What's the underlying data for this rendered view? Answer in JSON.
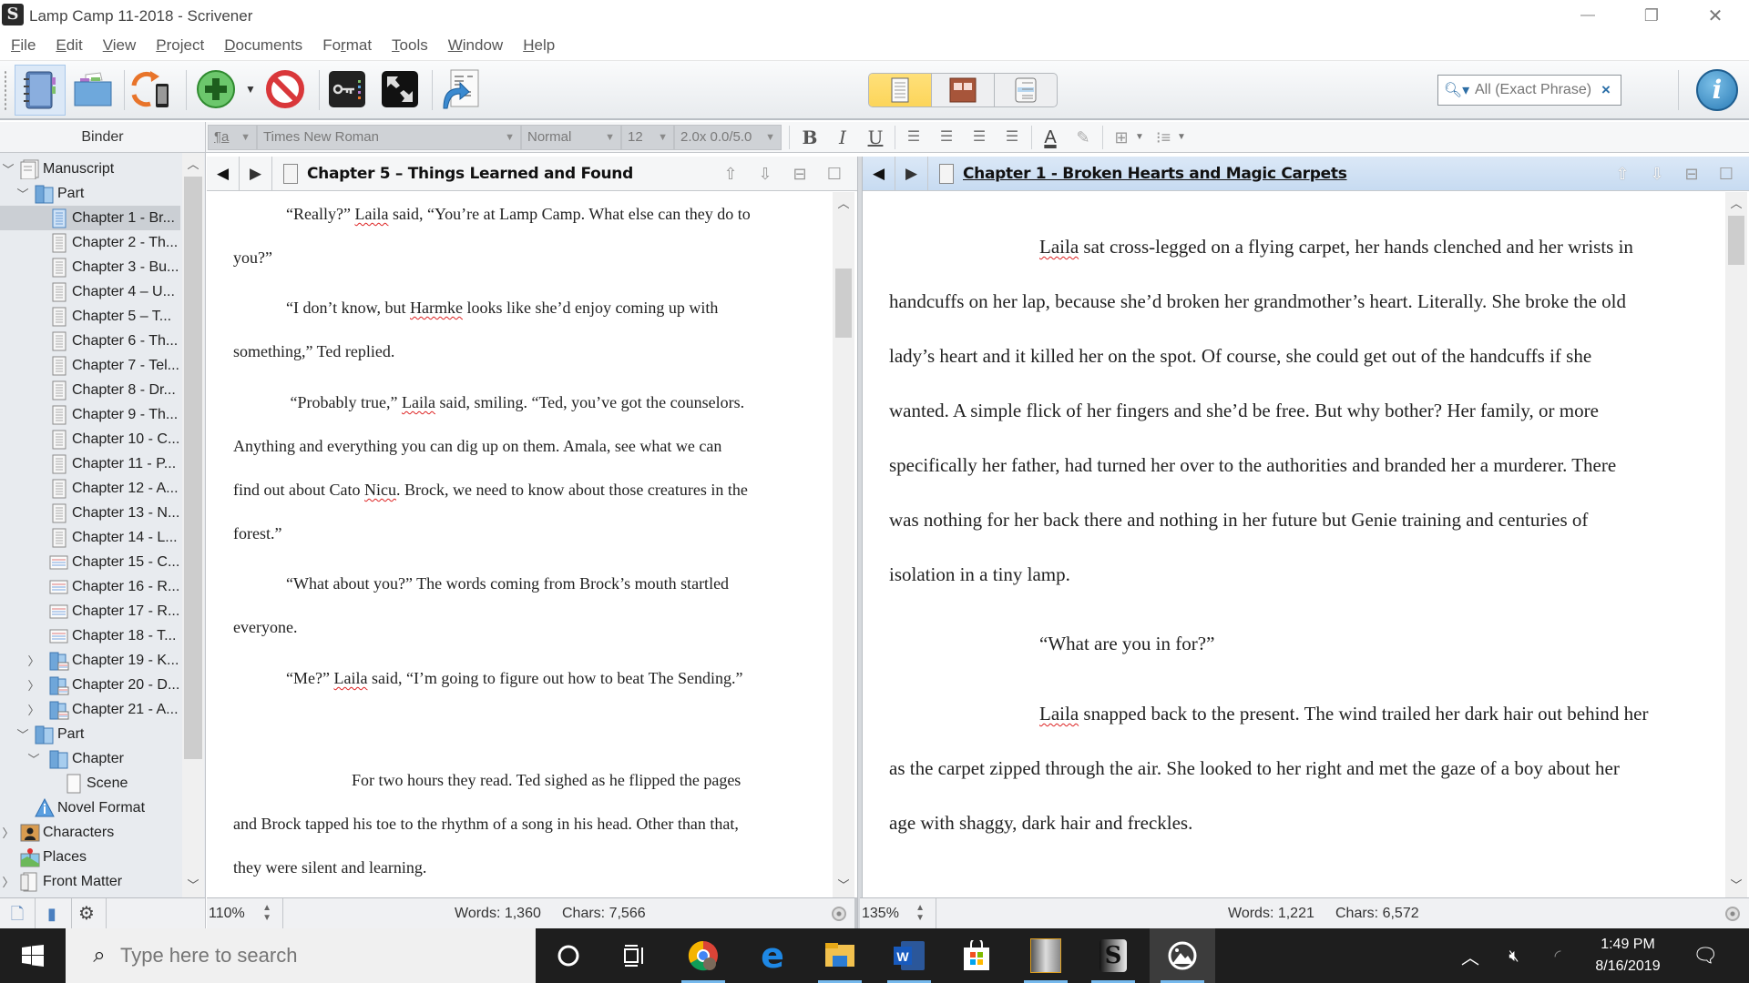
{
  "window": {
    "title": "Lamp Camp 11-2018 - Scrivener",
    "controls": {
      "minimize": "—",
      "restore": "❐",
      "close": "✕"
    }
  },
  "menu": [
    {
      "label": "File",
      "accel": "F",
      "rest": "ile"
    },
    {
      "label": "Edit",
      "accel": "E",
      "rest": "dit"
    },
    {
      "label": "View",
      "accel": "V",
      "rest": "iew"
    },
    {
      "label": "Project",
      "accel": "P",
      "rest": "roject"
    },
    {
      "label": "Documents",
      "accel": "D",
      "rest": "ocuments"
    },
    {
      "label": "Format",
      "pre": "Fo",
      "accel": "r",
      "rest": "mat"
    },
    {
      "label": "Tools",
      "accel": "T",
      "rest": "ools"
    },
    {
      "label": "Window",
      "accel": "W",
      "rest": "indow"
    },
    {
      "label": "Help",
      "accel": "H",
      "rest": "elp"
    }
  ],
  "toolbar": {
    "buttons": [
      "binder",
      "collections",
      "sync",
      "add",
      "add-dropdown",
      "delete",
      "keywords",
      "composition-mode",
      "compile"
    ],
    "view_modes": [
      "scrivenings",
      "corkboard",
      "outliner"
    ],
    "active_view_mode": "scrivenings",
    "search": {
      "placeholder": "All (Exact Phrase)",
      "value": ""
    },
    "colors": {
      "view_active": "#fcd55a",
      "info": "#2a7bb6"
    }
  },
  "binder": {
    "header": "Binder",
    "items": [
      {
        "label": "Manuscript",
        "level": 0,
        "disclosure": "open",
        "icon": "manuscript"
      },
      {
        "label": "Part",
        "level": 1,
        "disclosure": "open",
        "icon": "folder"
      },
      {
        "label": "Chapter 1 - Br...",
        "level": 2,
        "icon": "doc-blue",
        "selected": true
      },
      {
        "label": "Chapter 2 - Th...",
        "level": 2,
        "icon": "doc"
      },
      {
        "label": "Chapter 3 - Bu...",
        "level": 2,
        "icon": "doc"
      },
      {
        "label": "Chapter 4 – U...",
        "level": 2,
        "icon": "doc"
      },
      {
        "label": "Chapter 5 – T...",
        "level": 2,
        "icon": "doc"
      },
      {
        "label": "Chapter 6 - Th...",
        "level": 2,
        "icon": "doc"
      },
      {
        "label": "Chapter 7 - Tel...",
        "level": 2,
        "icon": "doc"
      },
      {
        "label": "Chapter 8 - Dr...",
        "level": 2,
        "icon": "doc"
      },
      {
        "label": "Chapter 9 - Th...",
        "level": 2,
        "icon": "doc"
      },
      {
        "label": "Chapter 10 - C...",
        "level": 2,
        "icon": "doc"
      },
      {
        "label": "Chapter 11 - P...",
        "level": 2,
        "icon": "doc"
      },
      {
        "label": "Chapter 12 - A...",
        "level": 2,
        "icon": "doc"
      },
      {
        "label": "Chapter 13 - N...",
        "level": 2,
        "icon": "doc"
      },
      {
        "label": "Chapter 14 - L...",
        "level": 2,
        "icon": "doc"
      },
      {
        "label": "Chapter 15 - C...",
        "level": 2,
        "icon": "doc-lined"
      },
      {
        "label": "Chapter 16 - R...",
        "level": 2,
        "icon": "doc-lined"
      },
      {
        "label": "Chapter 17 - R...",
        "level": 2,
        "icon": "doc-lined"
      },
      {
        "label": "Chapter 18 - T...",
        "level": 2,
        "icon": "doc-lined"
      },
      {
        "label": "Chapter 19 - K...",
        "level": 2,
        "disclosure": "closed",
        "icon": "folder-doc"
      },
      {
        "label": "Chapter 20 - D...",
        "level": 2,
        "disclosure": "closed",
        "icon": "folder-doc"
      },
      {
        "label": "Chapter 21 - A...",
        "level": 2,
        "disclosure": "closed",
        "icon": "folder-doc"
      },
      {
        "label": "Part",
        "level": 1,
        "disclosure": "open",
        "icon": "folder"
      },
      {
        "label": "Chapter",
        "level": 2,
        "disclosure": "open",
        "icon": "folder"
      },
      {
        "label": "Scene",
        "level": 3,
        "icon": "blank"
      },
      {
        "label": "Novel Format",
        "level": 1,
        "icon": "info-triangle"
      },
      {
        "label": "Characters",
        "level": 0,
        "disclosure": "closed",
        "icon": "characters"
      },
      {
        "label": "Places",
        "level": 0,
        "icon": "places"
      },
      {
        "label": "Front Matter",
        "level": 0,
        "disclosure": "closed",
        "icon": "front-matter"
      }
    ]
  },
  "format_bar": {
    "style": "¶a",
    "font": "Times New Roman",
    "typeface": "Normal",
    "size": "12",
    "spacing": "2.0x 0.0/5.0",
    "buttons": {
      "bold": "B",
      "italic": "I",
      "underline": "U"
    }
  },
  "editors": {
    "left": {
      "title": "Chapter 5 – Things Learned and Found",
      "zoom": "110%",
      "words": "Words: 1,360",
      "chars": "Chars: 7,566",
      "scroll_fraction": 0.1,
      "paragraphs": [
        {
          "lines": [
            "“Really?” ",
            "Laila",
            " said, “You’re at Lamp Camp. What else can they do to",
            "you?”"
          ]
        },
        {
          "lines": [
            "“I don’t know, but ",
            "Harmke",
            " looks like she’d enjoy coming up with",
            "something,” Ted replied."
          ]
        },
        {
          "lines": [
            " “Probably true,” ",
            "Laila",
            " said, smiling. “Ted, you’ve got the counselors.",
            "Anything and everything you can dig up on them. Amala, see what we can",
            "find out about Cato ",
            "Nicu",
            ". Brock, we need to know about those creatures in the",
            "forest.”"
          ]
        },
        {
          "lines": [
            "“What about you?” The words coming from Brock’s mouth startled",
            "everyone."
          ]
        },
        {
          "lines": [
            "“Me?” ",
            "Laila",
            " said, “I’m going to figure out how to beat The Sending.”"
          ]
        },
        {
          "lines": [
            "For two hours they read. Ted sighed as he flipped the pages",
            "and Brock tapped his toe to the rhythm of a song in his head. Other than that,",
            "they were silent and learning."
          ]
        }
      ]
    },
    "right": {
      "title": "Chapter 1 - Broken Hearts and Magic Carpets",
      "zoom": "135%",
      "words": "Words: 1,221",
      "chars": "Chars: 6,572",
      "scroll_fraction": 0.0,
      "paragraphs": [
        {
          "lines": [
            "Laila",
            " sat cross-legged on a flying carpet, her hands clenched and her wrists in",
            "handcuffs on her lap, because she’d broken her grandmother’s heart. Literally. She broke the old",
            "lady’s heart and it killed her on the spot. Of course, she could get out of the handcuffs if she",
            "wanted. A simple flick of her fingers and she’d be free. But why bother? Her family, or more",
            "specifically her father, had turned her over to the authorities and branded her a murderer. There",
            "was nothing for her back there and nothing in her future but Genie training and centuries of",
            "isolation in a tiny lamp."
          ]
        },
        {
          "lines": [
            "“What are you in for?”"
          ]
        },
        {
          "lines": [
            "Laila",
            " snapped back to the present. The wind trailed her dark hair out behind her",
            "as the carpet zipped through the air. She looked to her right and met the gaze of a boy about her",
            "age with shaggy, dark hair and freckles."
          ]
        }
      ]
    }
  },
  "taskbar": {
    "search_placeholder": "Type here to search",
    "apps": [
      "cortana",
      "task-view",
      "chrome",
      "edge",
      "file-explorer",
      "word",
      "store",
      "stormtrooper-app",
      "scrivener",
      "photos"
    ],
    "time": "1:49 PM",
    "date": "8/16/2019"
  }
}
